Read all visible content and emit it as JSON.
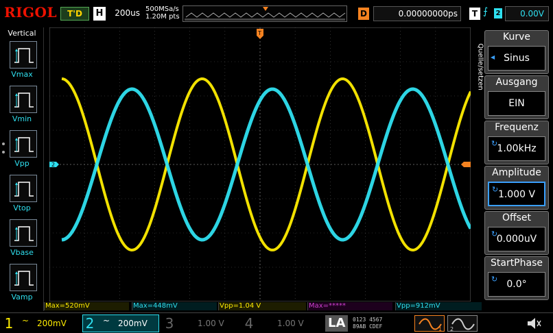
{
  "header": {
    "brand": "RIGOL",
    "run_status": "T'D",
    "timebase_label": "H",
    "timebase_value": "200us",
    "sample_rate": "500MSa/s",
    "memory_depth": "1.20M pts",
    "delay_label": "D",
    "delay_value": "0.00000000ps",
    "trigger_label": "T",
    "trigger_source": "2",
    "trigger_level": "0.00V"
  },
  "left_menu": {
    "title": "Vertical",
    "items": [
      {
        "label": "Vmax",
        "icon": "vmax-icon"
      },
      {
        "label": "Vmin",
        "icon": "vmin-icon"
      },
      {
        "label": "Vpp",
        "icon": "vpp-icon"
      },
      {
        "label": "Vtop",
        "icon": "vtop-icon"
      },
      {
        "label": "Vbase",
        "icon": "vbase-icon"
      },
      {
        "label": "Vamp",
        "icon": "vamp-icon"
      }
    ]
  },
  "measurements": [
    {
      "text": "Max=520mV",
      "color": "yellow"
    },
    {
      "text": "Max=448mV",
      "color": "cyan"
    },
    {
      "text": "Vpp=1.04 V",
      "color": "yellow"
    },
    {
      "text": "Max=*****",
      "color": "purple"
    },
    {
      "text": "Vpp=912mV",
      "color": "cyan"
    }
  ],
  "right_menu": {
    "tab_title": "Quelle/setzen",
    "cards": [
      {
        "label": "Kurve",
        "value": "Sinus",
        "has_arrow": true,
        "has_knob": false,
        "selected": false
      },
      {
        "label": "Ausgang",
        "value": "EIN",
        "has_arrow": false,
        "has_knob": false,
        "selected": false
      },
      {
        "label": "Frequenz",
        "value": "1.00kHz",
        "has_arrow": false,
        "has_knob": true,
        "selected": false
      },
      {
        "label": "Amplitude",
        "value": "1.000 V",
        "has_arrow": false,
        "has_knob": true,
        "selected": true
      },
      {
        "label": "Offset",
        "value": "0.000uV",
        "has_arrow": false,
        "has_knob": true,
        "selected": false
      },
      {
        "label": "StartPhase",
        "value": "0.0°",
        "has_arrow": false,
        "has_knob": true,
        "selected": false
      }
    ]
  },
  "channels": [
    {
      "num": "1",
      "coupling": "~",
      "scale": "200mV",
      "color": "#ffed00",
      "active": true
    },
    {
      "num": "2",
      "coupling": "~",
      "scale": "200mV",
      "color": "#2fe0f0",
      "active": true
    },
    {
      "num": "3",
      "coupling": "",
      "scale": "1.00 V",
      "color": "#555555",
      "active": false
    },
    {
      "num": "4",
      "coupling": "",
      "scale": "1.00 V",
      "color": "#555555",
      "active": false
    }
  ],
  "la": {
    "label": "LA",
    "row1": "0123 4567",
    "row2": "89AB CDEF"
  },
  "generators": [
    "1",
    "2"
  ],
  "screen": {
    "ch2_marker": "2",
    "trigger_marker": "T"
  },
  "chart_data": {
    "type": "line",
    "series": [
      {
        "channel": "1",
        "color": "#ffed00",
        "amplitude_div": 2.5,
        "period_div": 4,
        "phase": "cosine"
      },
      {
        "channel": "2",
        "color": "#2fe0f0",
        "amplitude_div": 2.2,
        "period_div": 4,
        "phase": "inverted-cosine"
      }
    ],
    "x_divisions": 12,
    "y_divisions": 8,
    "grid": true
  },
  "colors": {
    "ch1": "#ffed00",
    "ch2": "#2fe0f0",
    "trigger": "#f58220",
    "accent": "#3aa0ff"
  }
}
